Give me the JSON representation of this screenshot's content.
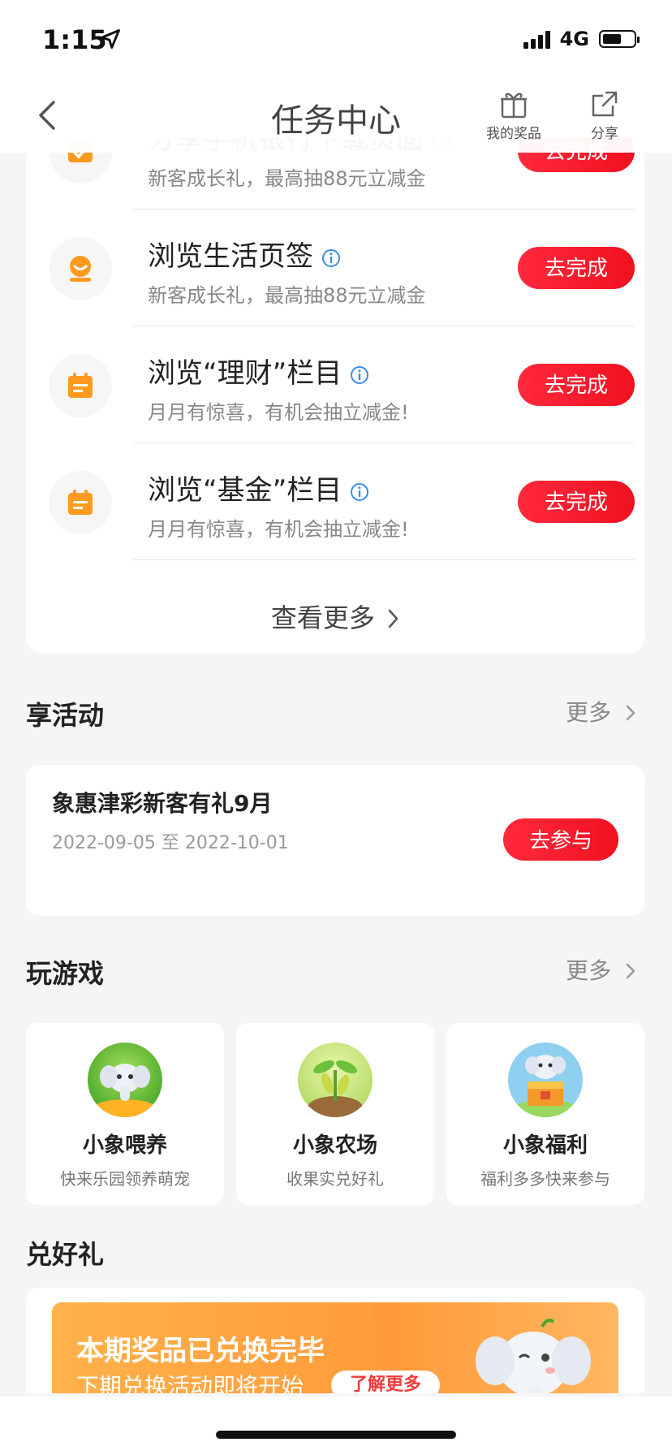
{
  "status": {
    "time": "1:15",
    "network": "4G"
  },
  "nav": {
    "title": "任务中心",
    "prize_label": "我的奖品",
    "share_label": "分享"
  },
  "tasks": [
    {
      "title": "分享手机银行下载页面",
      "desc": "新客成长礼，最高抽88元立减金",
      "button": "去完成"
    },
    {
      "title": "浏览生活页签",
      "desc": "新客成长礼，最高抽88元立减金",
      "button": "去完成"
    },
    {
      "title": "浏览“理财”栏目",
      "desc": "月月有惊喜，有机会抽立减金!",
      "button": "去完成"
    },
    {
      "title": "浏览“基金”栏目",
      "desc": "月月有惊喜，有机会抽立减金!",
      "button": "去完成"
    }
  ],
  "see_more": "查看更多",
  "activities": {
    "section_title": "享活动",
    "more": "更多",
    "item": {
      "name": "象惠津彩新客有礼9月",
      "date": "2022-09-05 至 2022-10-01",
      "button": "去参与"
    }
  },
  "games": {
    "section_title": "玩游戏",
    "more": "更多",
    "items": [
      {
        "name": "小象喂养",
        "desc": "快来乐园领养萌宠"
      },
      {
        "name": "小象农场",
        "desc": "收果实兑好礼"
      },
      {
        "name": "小象福利",
        "desc": "福利多多快来参与"
      }
    ]
  },
  "gifts": {
    "section_title": "兑好礼",
    "banner_title": "本期奖品已兑换完毕",
    "banner_sub": "下期兑换活动即将开始",
    "banner_button": "了解更多"
  },
  "colors": {
    "accent_red": "#f01020",
    "task_icon_orange": "#ff9a1f",
    "info_blue": "#3a8ee6"
  }
}
